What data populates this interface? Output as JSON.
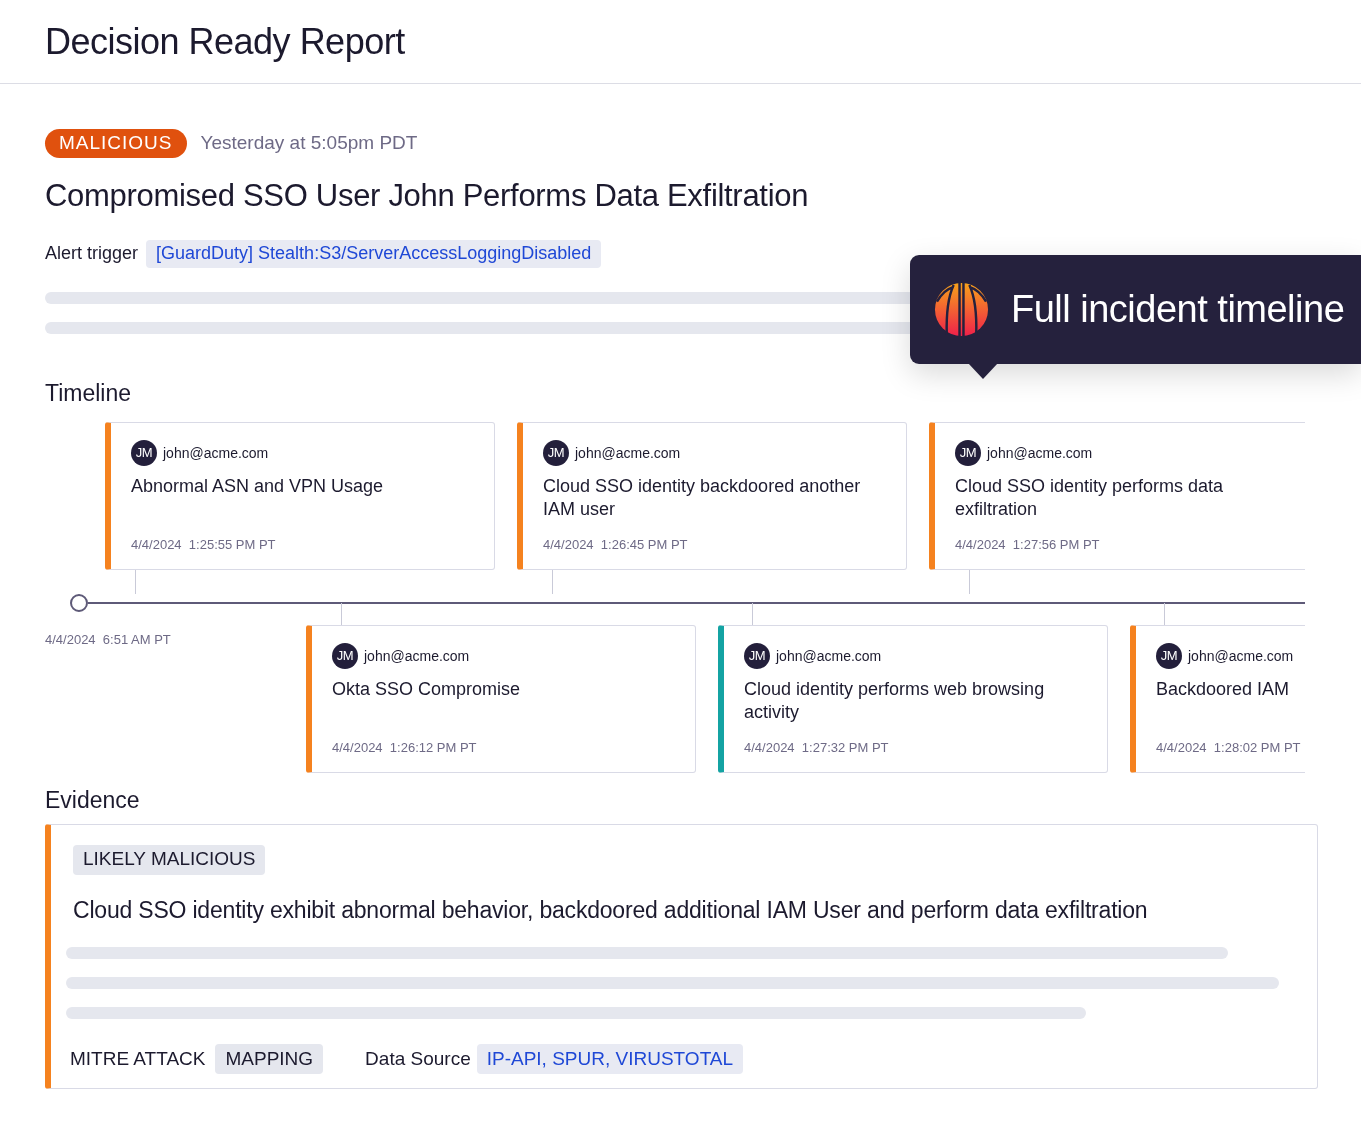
{
  "header": {
    "title": "Decision Ready Report"
  },
  "alert": {
    "verdict": "MALICIOUS",
    "time": "Yesterday at 5:05pm PDT",
    "title": "Compromised SSO User John Performs Data Exfiltration",
    "trigger_label": "Alert trigger",
    "trigger": "[GuardDuty] Stealth:S3/ServerAccessLoggingDisabled"
  },
  "tooltip": {
    "text": "Full incident timeline"
  },
  "timeline": {
    "heading": "Timeline",
    "start": "4/4/2024  6:51 AM PT",
    "top_events": [
      {
        "initials": "JM",
        "user": "john@acme.com",
        "title": "Abnormal ASN and VPN Usage",
        "time": "4/4/2024  1:25:55 PM PT",
        "color": "#f5821f"
      },
      {
        "initials": "JM",
        "user": "john@acme.com",
        "title": "Cloud SSO identity backdoored another IAM user",
        "time": "4/4/2024  1:26:45 PM PT",
        "color": "#f5821f"
      },
      {
        "initials": "JM",
        "user": "john@acme.com",
        "title": "Cloud SSO identity performs data exfiltration",
        "time": "4/4/2024  1:27:56 PM PT",
        "color": "#f5821f"
      }
    ],
    "bottom_events": [
      {
        "initials": "JM",
        "user": "john@acme.com",
        "title": "Okta SSO Compromise",
        "time": "4/4/2024  1:26:12 PM PT",
        "color": "#f5821f"
      },
      {
        "initials": "JM",
        "user": "john@acme.com",
        "title": "Cloud identity performs web browsing activity",
        "time": "4/4/2024  1:27:32 PM PT",
        "color": "#14a3a3"
      },
      {
        "initials": "JM",
        "user": "john@acme.com",
        "title": "Backdoored IAM",
        "time": "4/4/2024  1:28:02 PM PT",
        "color": "#f5821f"
      }
    ]
  },
  "evidence": {
    "heading": "Evidence",
    "verdict": "LIKELY MALICIOUS",
    "summary": "Cloud SSO identity exhibit abnormal behavior, backdoored additional IAM User and perform data exfiltration",
    "mitre_label": "MITRE ATTACK",
    "mitre_value": "MAPPING",
    "source_label": "Data Source",
    "source_value": "IP-API, SPUR, VIRUSTOTAL"
  }
}
